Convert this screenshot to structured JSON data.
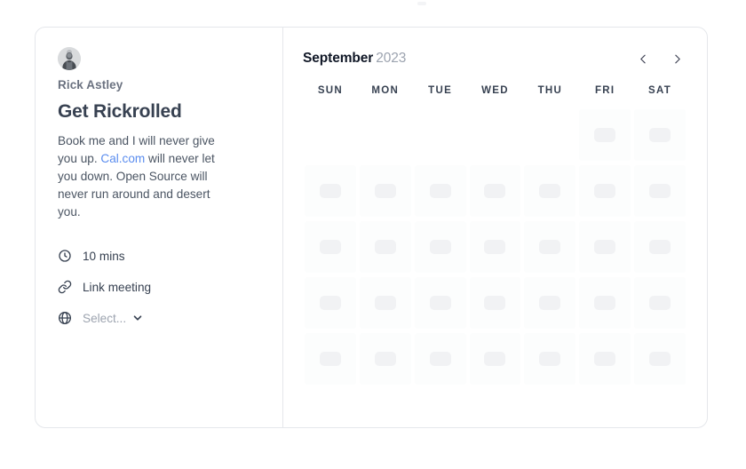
{
  "page": {
    "background": "#ffffff",
    "card_border_color": "#e5e7eb",
    "accent_link_color": "#5b8def",
    "skeleton_cell_color": "#fcfdfd",
    "skeleton_pill_color": "#f1f2f4"
  },
  "event": {
    "avatar_icon": "user-avatar-photo",
    "profile_name": "Rick Astley",
    "title": "Get Rickrolled",
    "description_part_1": "Book me and I will never give you up. ",
    "description_link_text": "Cal.com",
    "description_part_2": " will never let you down. Open Source will never run around and desert you.",
    "meta": [
      {
        "icon": "clock-icon",
        "label": "10 mins",
        "muted": false
      },
      {
        "icon": "link-icon",
        "label": "Link meeting",
        "muted": false
      },
      {
        "icon": "globe-icon",
        "label": "Select...",
        "muted": true,
        "has_chevron": true
      }
    ]
  },
  "calendar": {
    "month": "September",
    "year": "2023",
    "prev_label": "chevron-left-icon",
    "next_label": "chevron-right-icon",
    "weekdays": [
      "SUN",
      "MON",
      "TUE",
      "WED",
      "THU",
      "FRI",
      "SAT"
    ],
    "state": "loading-skeleton",
    "rows": 5,
    "columns": 7,
    "leading_blank_cells": 5,
    "cells": [
      [
        false,
        false,
        false,
        false,
        false,
        true,
        true
      ],
      [
        true,
        true,
        true,
        true,
        true,
        true,
        true
      ],
      [
        true,
        true,
        true,
        true,
        true,
        true,
        true
      ],
      [
        true,
        true,
        true,
        true,
        true,
        true,
        true
      ],
      [
        true,
        true,
        true,
        true,
        true,
        true,
        true
      ]
    ]
  }
}
